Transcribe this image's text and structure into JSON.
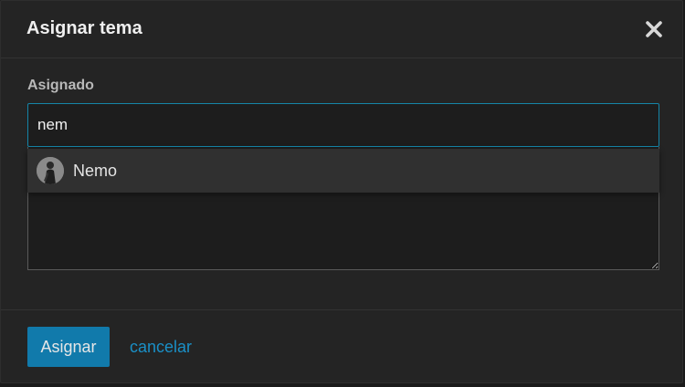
{
  "dialog": {
    "title": "Asignar tema",
    "close_icon": "close-icon"
  },
  "assignee": {
    "label": "Asignado",
    "input_value": "nem"
  },
  "suggestions": [
    {
      "label": "Nemo",
      "icon": "avatar"
    }
  ],
  "actions": {
    "primary_label": "Asignar",
    "cancel_label": "cancelar"
  },
  "colors": {
    "accent": "#117aab",
    "link": "#1a8fc6",
    "input_focus_border": "#1585a8",
    "background": "#242424"
  }
}
